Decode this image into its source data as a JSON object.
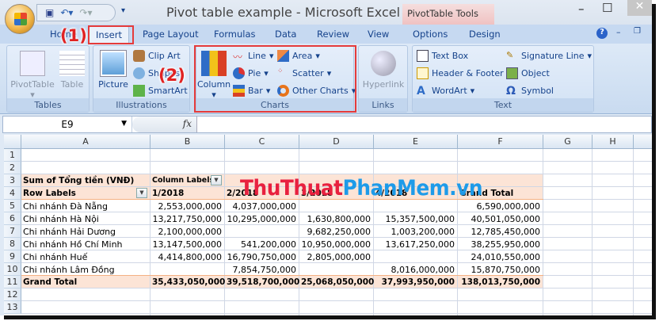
{
  "window": {
    "title": "Pivot table example - Microsoft Excel",
    "context_tab": "PivotTable Tools"
  },
  "tabs": [
    "Home",
    "Insert",
    "Page Layout",
    "Formulas",
    "Data",
    "Review",
    "View",
    "Options",
    "Design"
  ],
  "annotations": [
    "(1)",
    "(2)"
  ],
  "ribbon": {
    "tables": {
      "label": "Tables",
      "pivottable": "PivotTable",
      "table": "Table"
    },
    "illustrations": {
      "label": "Illustrations",
      "picture": "Picture",
      "clipart": "Clip Art",
      "shapes": "Shapes",
      "smartart": "SmartArt"
    },
    "charts": {
      "label": "Charts",
      "column": "Column",
      "line": "Line",
      "pie": "Pie",
      "bar": "Bar",
      "area": "Area",
      "scatter": "Scatter",
      "other": "Other Charts"
    },
    "links": {
      "label": "Links",
      "hyperlink": "Hyperlink"
    },
    "text": {
      "label": "Text",
      "textbox": "Text Box",
      "header_footer": "Header & Footer",
      "wordart": "WordArt",
      "signature": "Signature Line",
      "object": "Object",
      "symbol": "Symbol"
    }
  },
  "formula_bar": {
    "name_box": "E9",
    "fx": "fx",
    "value": ""
  },
  "columns": [
    "A",
    "B",
    "C",
    "D",
    "E",
    "F",
    "G",
    "H"
  ],
  "rows": [
    "1",
    "2",
    "3",
    "4",
    "5",
    "6",
    "7",
    "8",
    "9",
    "10",
    "11",
    "12",
    "13"
  ],
  "watermark": {
    "part1": "ThuThuat",
    "part2": "PhanMem",
    "part3": ".vn"
  },
  "pivot": {
    "value_label": "Sum of Tổng tiền (VNĐ)",
    "column_labels": "Column Labels",
    "row_labels": "Row Labels",
    "headers": [
      "1/2018",
      "2/2018",
      "3/2018",
      "4/2018",
      "Grand Total"
    ],
    "data": [
      {
        "name": "Chi nhánh Đà Nẵng",
        "values": [
          "2,553,000,000",
          "4,037,000,000",
          "",
          "",
          "6,590,000,000"
        ]
      },
      {
        "name": "Chi nhánh Hà Nội",
        "values": [
          "13,217,750,000",
          "10,295,000,000",
          "1,630,800,000",
          "15,357,500,000",
          "40,501,050,000"
        ]
      },
      {
        "name": "Chi nhánh Hải Dương",
        "values": [
          "2,100,000,000",
          "",
          "9,682,250,000",
          "1,003,200,000",
          "12,785,450,000"
        ]
      },
      {
        "name": "Chi nhánh Hồ Chí Minh",
        "values": [
          "13,147,500,000",
          "541,200,000",
          "10,950,000,000",
          "13,617,250,000",
          "38,255,950,000"
        ]
      },
      {
        "name": "Chi nhánh Huế",
        "values": [
          "4,414,800,000",
          "16,790,750,000",
          "2,805,000,000",
          "",
          "24,010,550,000"
        ]
      },
      {
        "name": "Chi nhánh Lâm Đồng",
        "values": [
          "",
          "7,854,750,000",
          "",
          "8,016,000,000",
          "15,870,750,000"
        ]
      }
    ],
    "grand_total": {
      "name": "Grand Total",
      "values": [
        "35,433,050,000",
        "39,518,700,000",
        "25,068,050,000",
        "37,993,950,000",
        "138,013,750,000"
      ]
    }
  }
}
